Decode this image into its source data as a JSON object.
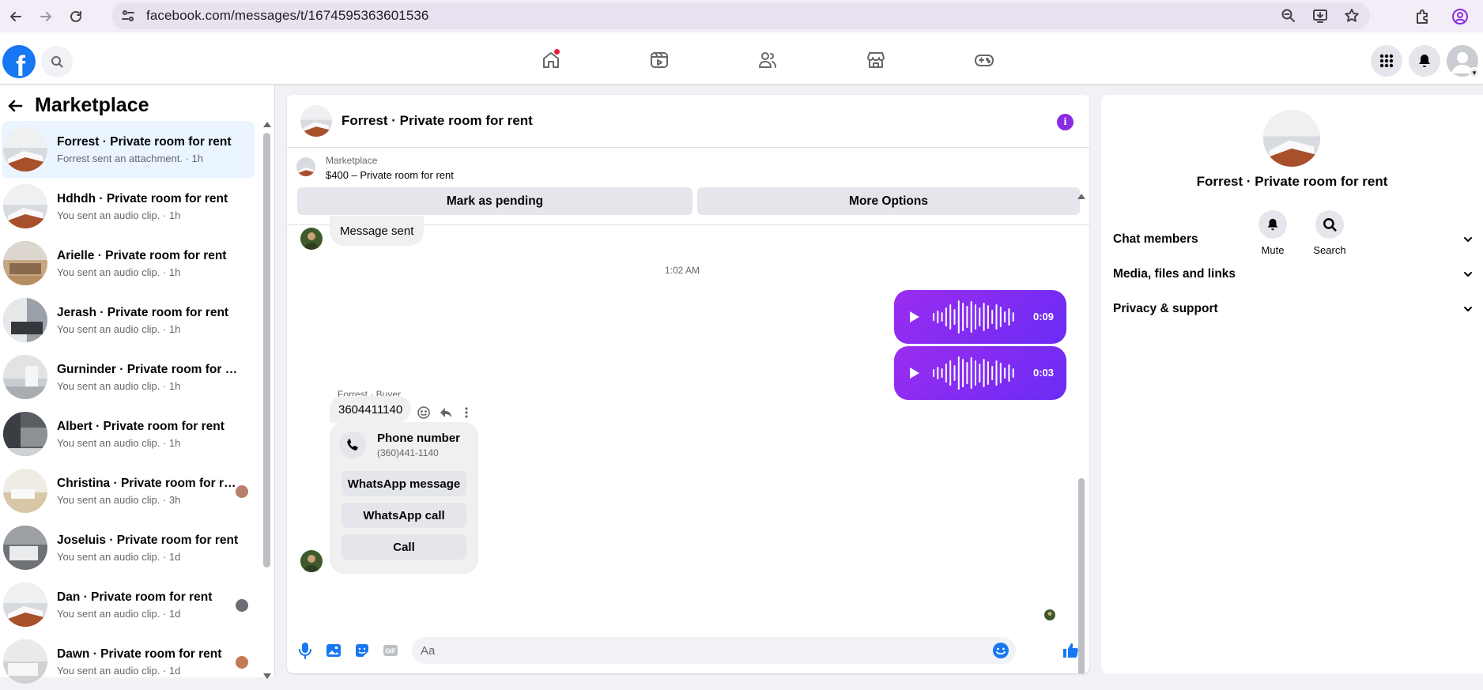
{
  "browser": {
    "url": "facebook.com/messages/t/1674595363601536"
  },
  "left": {
    "title": "Marketplace",
    "conversations": [
      {
        "name": "Forrest · Private room for rent",
        "sub": "Forrest sent an attachment. · 1h"
      },
      {
        "name": "Hdhdh · Private room for rent",
        "sub": "You sent an audio clip. · 1h"
      },
      {
        "name": "Arielle · Private room for rent",
        "sub": "You sent an audio clip. · 1h"
      },
      {
        "name": "Jerash · Private room for rent",
        "sub": "You sent an audio clip. · 1h"
      },
      {
        "name": "Gurninder · Private room for rent",
        "sub": "You sent an audio clip. · 1h"
      },
      {
        "name": "Albert · Private room for rent",
        "sub": "You sent an audio clip. · 1h"
      },
      {
        "name": "Christina · Private room for re...",
        "sub": "You sent an audio clip. · 3h"
      },
      {
        "name": "Joseluis · Private room for rent",
        "sub": "You sent an audio clip. · 1d"
      },
      {
        "name": "Dan · Private room for rent",
        "sub": "You sent an audio clip. · 1d"
      },
      {
        "name": "Dawn · Private room for rent",
        "sub": "You sent an audio clip. · 1d"
      }
    ]
  },
  "chat": {
    "title": "Forrest · Private room for rent",
    "marketplace_label": "Marketplace",
    "listing": "$400 – Private room for rent",
    "mark_pending": "Mark as pending",
    "more_options": "More Options",
    "message_sent": "Message sent",
    "timestamp": "1:02 AM",
    "audio1_duration": "0:09",
    "audio2_duration": "0:03",
    "sender_label": "Forrest · Buyer",
    "phone_message": "3604411140",
    "card_title": "Phone number",
    "card_number": "(360)441-1140",
    "whatsapp_message": "WhatsApp message",
    "whatsapp_call": "WhatsApp call",
    "call": "Call",
    "input_placeholder": "Aa"
  },
  "info": {
    "title": "Forrest · Private room for rent",
    "mute": "Mute",
    "search": "Search",
    "sections": [
      "Chat members",
      "Media, files and links",
      "Privacy & support"
    ]
  },
  "colors": {
    "accent": "#1877f2",
    "audio_bubble": "#7b2cf2",
    "info_button": "#8a2be2"
  }
}
